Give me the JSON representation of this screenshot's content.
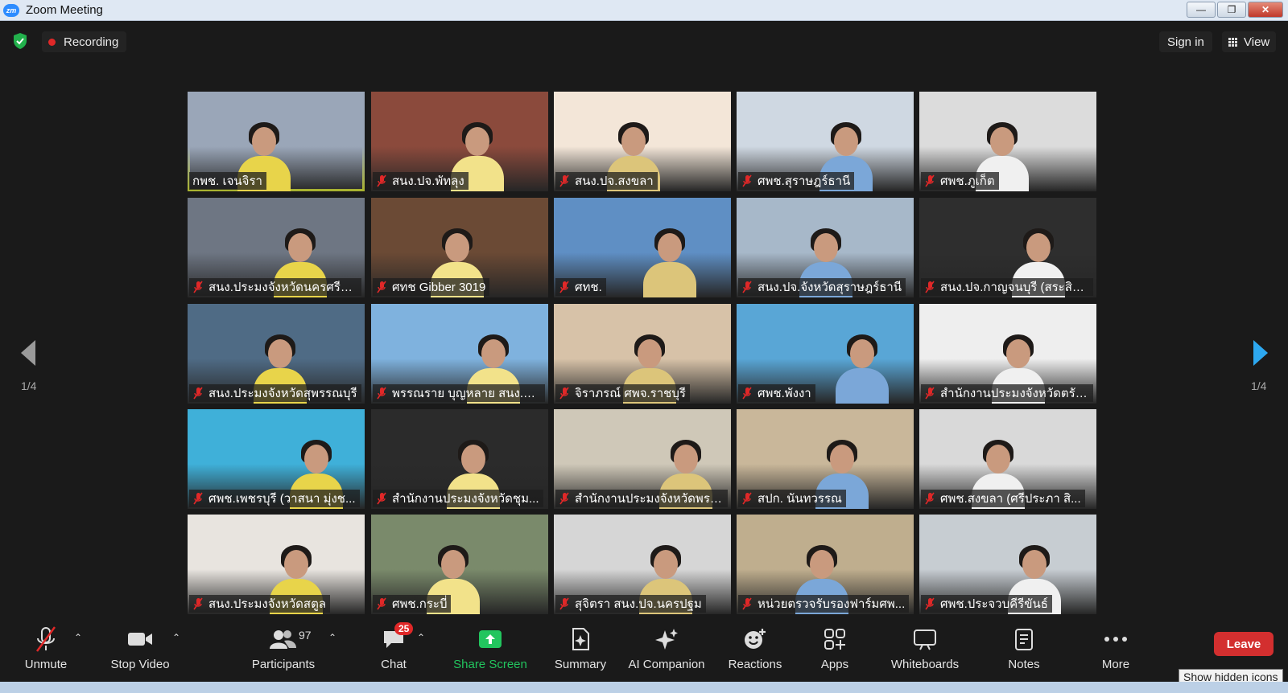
{
  "window": {
    "app_icon": "zm",
    "title": "Zoom Meeting",
    "minimize_icon": "minimize-icon",
    "maximize_icon": "restore-icon",
    "close_icon": "close-icon"
  },
  "topbar": {
    "recording_label": "Recording",
    "sign_in_label": "Sign in",
    "view_label": "View"
  },
  "pagination": {
    "left_label": "1/4",
    "right_label": "1/4"
  },
  "participants": [
    {
      "name": "กพช. เจนจิรา",
      "muted": false,
      "active": true,
      "bg": "#9aa6b8"
    },
    {
      "name": "สนง.ปจ.พัทลุง",
      "muted": true,
      "bg": "#8b4a3c"
    },
    {
      "name": "สนง.ปจ.สงขลา",
      "muted": true,
      "bg": "#f3e6d8"
    },
    {
      "name": "ศพช.สุราษฎร์ธานี",
      "muted": true,
      "bg": "#cfd8e2"
    },
    {
      "name": "ศพช.ภูเก็ต",
      "muted": true,
      "bg": "#dcdcdc"
    },
    {
      "name": "สนง.ประมงจังหวัดนครศรีธ...",
      "muted": true,
      "bg": "#6e7683"
    },
    {
      "name": "ศทช Gibber 3019",
      "muted": true,
      "bg": "#6b4a35"
    },
    {
      "name": "ศทช.",
      "muted": true,
      "bg": "#5f8fc4"
    },
    {
      "name": "สนง.ปจ.จังหวัดสุราษฎร์ธานี",
      "muted": true,
      "bg": "#a7b8c9"
    },
    {
      "name": "สนง.ปจ.กาญจนบุรี (สระสิท...",
      "muted": true,
      "bg": "#2e2e2e"
    },
    {
      "name": "สนง.ประมงจังหวัดสุพรรณบุรี",
      "muted": true,
      "bg": "#4f6b85"
    },
    {
      "name": "พรรณราย บุญหลาย สนง.ป...",
      "muted": true,
      "bg": "#7fb2de"
    },
    {
      "name": "จิราภรณ์ ศพจ.ราชบุรี",
      "muted": true,
      "bg": "#d7c2a8"
    },
    {
      "name": "ศพช.พังงา",
      "muted": true,
      "bg": "#59a6d6"
    },
    {
      "name": "สำนักงานประมงจังหวัดตรัง...",
      "muted": true,
      "bg": "#eeeeee"
    },
    {
      "name": "ศพช.เพชรบุรี (วาสนา มุ่งช...",
      "muted": true,
      "bg": "#3fb0d9"
    },
    {
      "name": "สำนักงานประมงจังหวัดชุม...",
      "muted": true,
      "bg": "#2b2b2b"
    },
    {
      "name": "สำนักงานประมงจังหวัดพระ...",
      "muted": true,
      "bg": "#cfc8b8"
    },
    {
      "name": "สปก. นันทวรรณ",
      "muted": true,
      "bg": "#c9b79a"
    },
    {
      "name": "ศพช.สงขลา (ศรีประภา สิ...",
      "muted": true,
      "bg": "#d9d9d9"
    },
    {
      "name": "สนง.ประมงจังหวัดสตูล",
      "muted": true,
      "bg": "#e8e4df"
    },
    {
      "name": "ศพช.กระบี่",
      "muted": true,
      "bg": "#7a8a6b"
    },
    {
      "name": "สุจิตรา สนง.ปจ.นครปฐม",
      "muted": true,
      "bg": "#d6d6d6"
    },
    {
      "name": "หน่วยตรวจรับรองฟาร์มศพ...",
      "muted": true,
      "bg": "#bfae8e"
    },
    {
      "name": "ศพช.ประจวบคีรีขันธ์",
      "muted": true,
      "bg": "#c7cdd2"
    }
  ],
  "toolbar": {
    "unmute": "Unmute",
    "stop_video": "Stop Video",
    "participants": "Participants",
    "participants_count": "97",
    "chat": "Chat",
    "chat_badge": "25",
    "share_screen": "Share Screen",
    "summary": "Summary",
    "ai_companion": "AI Companion",
    "reactions": "Reactions",
    "apps": "Apps",
    "whiteboards": "Whiteboards",
    "notes": "Notes",
    "more": "More",
    "leave": "Leave",
    "tooltip": "Show hidden icons"
  },
  "colors": {
    "background": "#1a1a1a",
    "active_speaker": "#e2ef3c",
    "share_green": "#22c55e",
    "leave_red": "#d32f2f",
    "badge_red": "#e02828",
    "arrow_blue": "#2da8f0"
  }
}
